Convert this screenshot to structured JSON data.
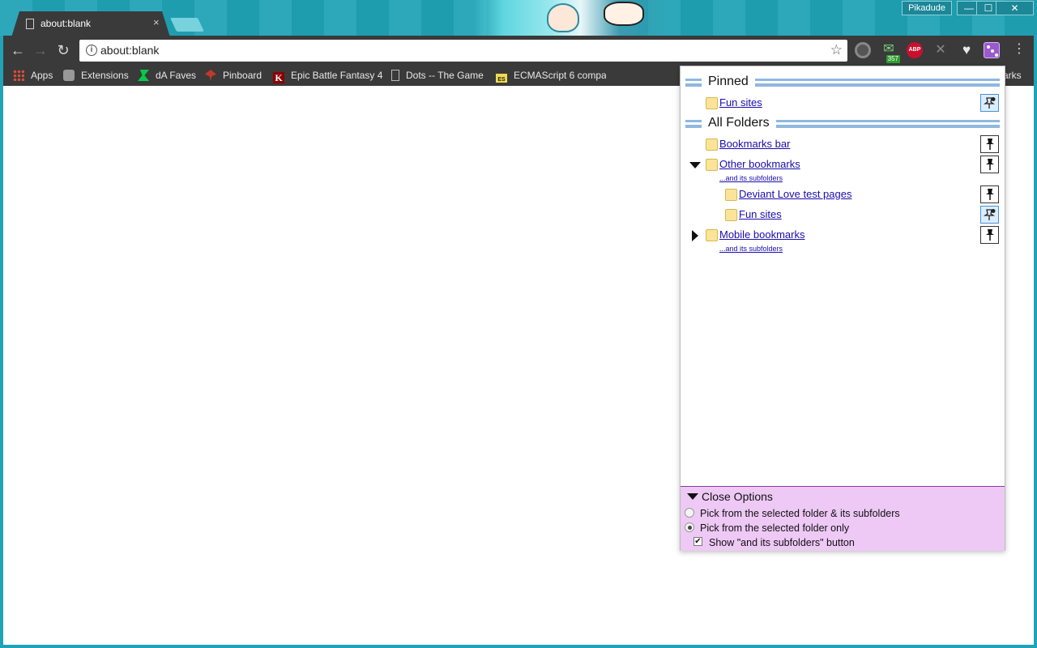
{
  "window": {
    "tab_title": "about:blank",
    "tab_close": "×",
    "user_button": "Pikadude",
    "minimize": "—",
    "maximize": "☐",
    "close": "✕"
  },
  "toolbar": {
    "back": "←",
    "forward": "→",
    "reload": "↻",
    "url": "about:blank",
    "star": "☆",
    "info": "i",
    "menu": "⋮"
  },
  "extensions": {
    "gmail_icon": "✉",
    "gmail_badge": "357",
    "abp_label": "ABP",
    "cross_icon": "✕",
    "heart_icon": "♥"
  },
  "bookmarks_bar": {
    "items": [
      {
        "label": "Apps",
        "icon": "apps-grid-icon"
      },
      {
        "label": "Extensions",
        "icon": "puzzle-icon"
      },
      {
        "label": "dA Faves",
        "icon": "deviantart-icon"
      },
      {
        "label": "Pinboard",
        "icon": "pinboard-icon"
      },
      {
        "label": "Epic Battle Fantasy 4",
        "icon": "k-icon"
      },
      {
        "label": "Dots -- The Game",
        "icon": "page-icon"
      },
      {
        "label": "ECMAScript 6 compa",
        "icon": "es-icon"
      }
    ],
    "overflow_text": "arks",
    "k_glyph": "K",
    "es_glyph": "ES"
  },
  "popup": {
    "pinned_header": "Pinned",
    "all_folders_header": "All Folders",
    "pinned": [
      {
        "label": "Fun sites",
        "pinned": true
      }
    ],
    "folders": [
      {
        "label": "Bookmarks bar",
        "pinned": false
      },
      {
        "label": "Other bookmarks",
        "expanded": true,
        "subfolders_link": "...and its subfolders",
        "pinned": false
      },
      {
        "label": "Deviant Love test pages",
        "pinned": false
      },
      {
        "label": "Fun sites",
        "pinned": true
      },
      {
        "label": "Mobile bookmarks",
        "expanded": false,
        "subfolders_link": "...and its subfolders",
        "pinned": false
      }
    ],
    "options": {
      "header": "Close Options",
      "radio_1": "Pick from the selected folder & its subfolders",
      "radio_2": "Pick from the selected folder only",
      "checkbox": "Show \"and its subfolders\" button",
      "selected_radio": 2,
      "checkbox_checked": true,
      "check_glyph": "✔"
    }
  },
  "colors": {
    "frame": "#1fa3b6",
    "toolbar": "#3a3a3a",
    "link": "#1a0dab",
    "options_bg": "#eec9f5",
    "section_lines": "#8eb8e0"
  }
}
